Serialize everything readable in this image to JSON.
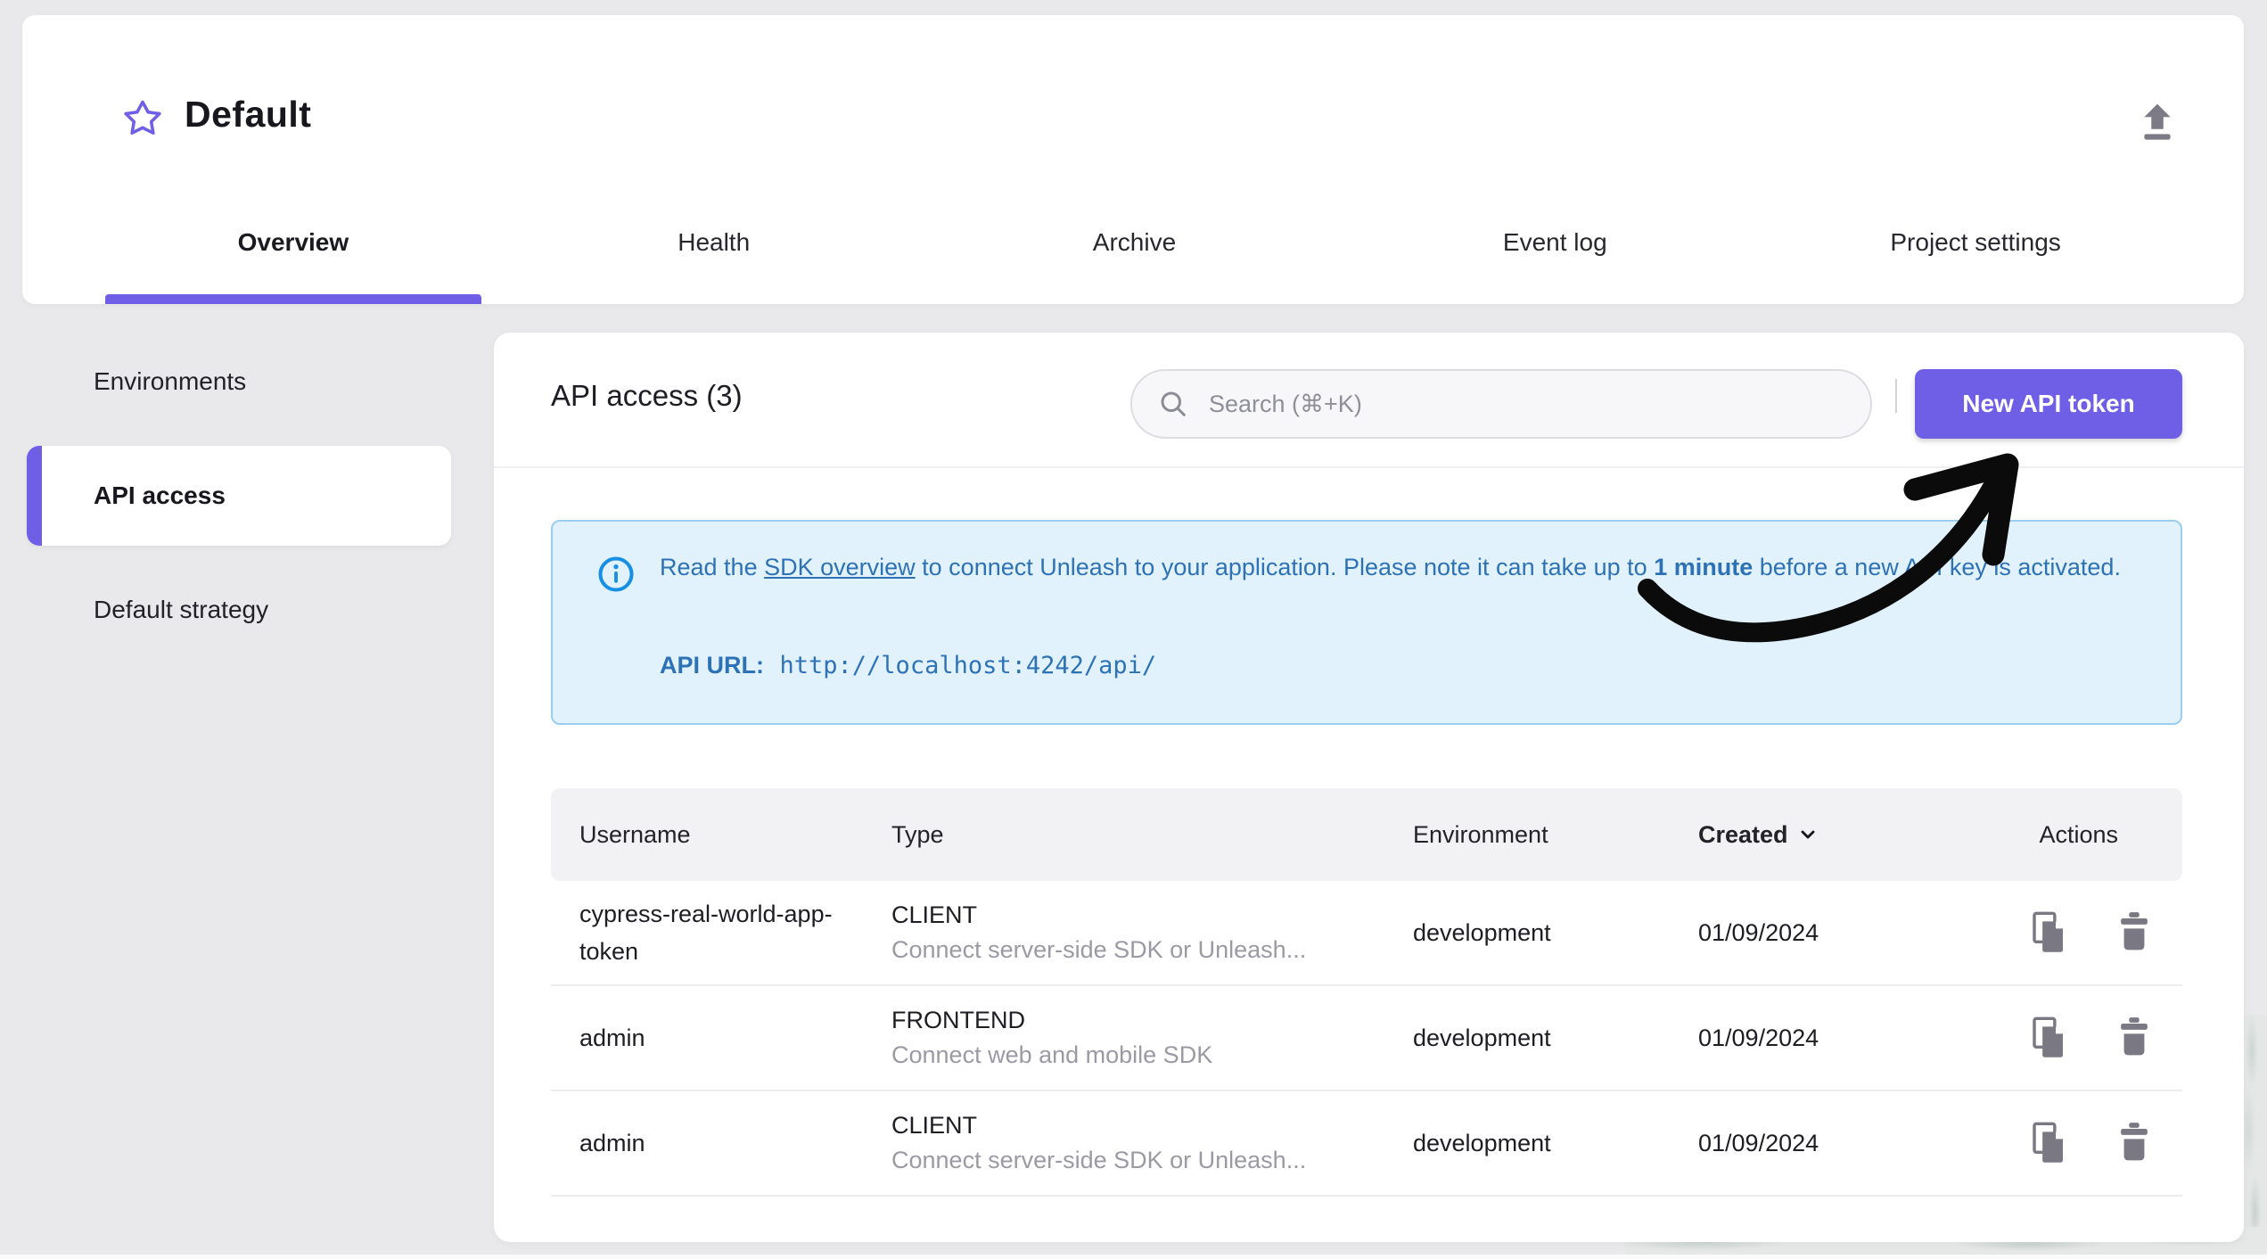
{
  "header": {
    "project_title": "Default",
    "tabs": [
      {
        "label": "Overview",
        "active": true
      },
      {
        "label": "Health",
        "active": false
      },
      {
        "label": "Archive",
        "active": false
      },
      {
        "label": "Event log",
        "active": false
      },
      {
        "label": "Project settings",
        "active": false
      }
    ]
  },
  "sidebar": {
    "items": [
      {
        "label": "Environments",
        "active": false
      },
      {
        "label": "API access",
        "active": true
      },
      {
        "label": "Default strategy",
        "active": false
      }
    ]
  },
  "content": {
    "heading": "API access (3)",
    "search": {
      "placeholder": "Search (⌘+K)"
    },
    "new_token_button": "New API token",
    "alert": {
      "part1": "Read the ",
      "link": "SDK overview",
      "part2": " to connect Unleash to your application. Please note it can take up to ",
      "bold": "1 minute",
      "part3": " before a new API key is activated.",
      "api_url_label": "API URL:",
      "api_url": "http://localhost:4242/api/"
    },
    "table": {
      "columns": {
        "username": "Username",
        "type": "Type",
        "environment": "Environment",
        "created": "Created",
        "actions": "Actions"
      },
      "sorted_by": "Created",
      "rows": [
        {
          "username": "cypress-real-world-app-token",
          "type": "CLIENT",
          "type_description": "Connect server-side SDK or Unleash...",
          "environment": "development",
          "created": "01/09/2024"
        },
        {
          "username": "admin",
          "type": "FRONTEND",
          "type_description": "Connect web and mobile SDK",
          "environment": "development",
          "created": "01/09/2024"
        },
        {
          "username": "admin",
          "type": "CLIENT",
          "type_description": "Connect server-side SDK or Unleash...",
          "environment": "development",
          "created": "01/09/2024"
        }
      ]
    }
  },
  "annotation": {
    "type": "hand-drawn-arrow",
    "color": "#0b0b0b",
    "points_to": "New API token button"
  },
  "colors": {
    "accent_purple": "#6E5FE6",
    "info_bg": "#E2F2FD",
    "info_border": "#9BCDF0",
    "info_text": "#2E72B6",
    "info_icon": "#168FE5",
    "page_bg": "#E9E9EB",
    "icon_gray": "#7A7983"
  }
}
